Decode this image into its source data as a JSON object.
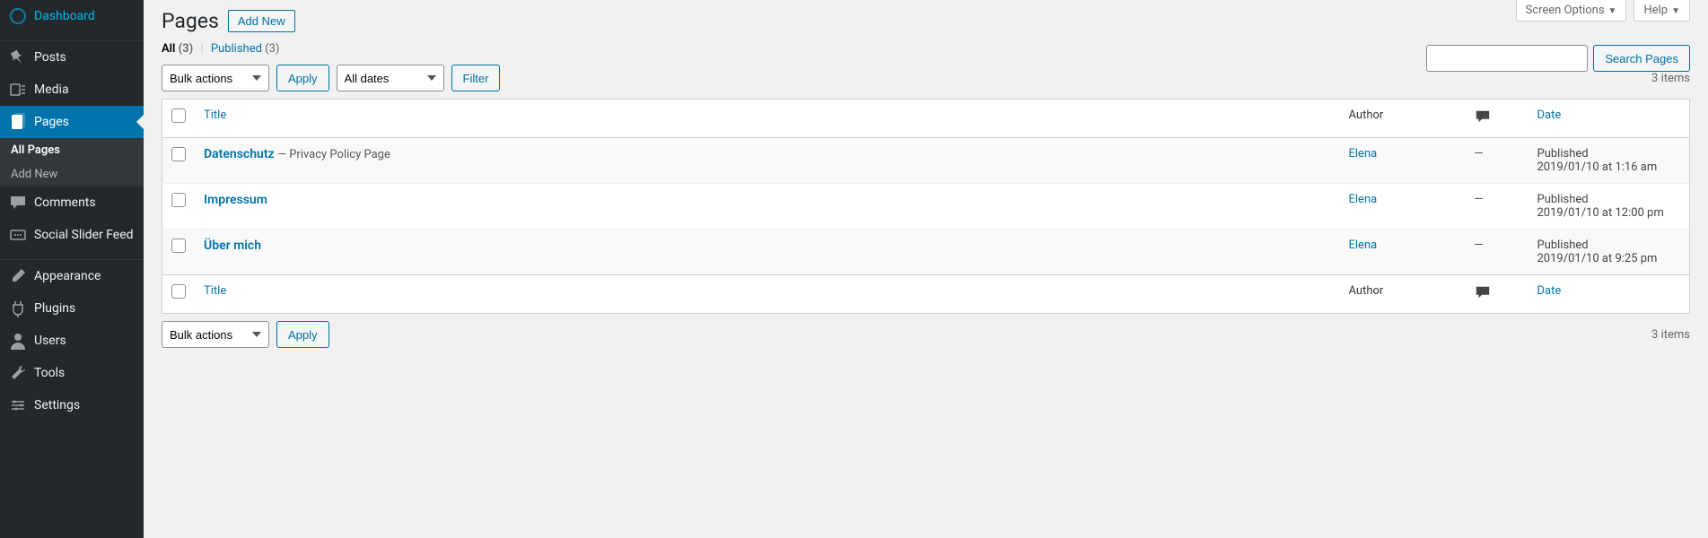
{
  "topTabs": {
    "screenOptions": "Screen Options",
    "help": "Help"
  },
  "sidebar": {
    "items": [
      {
        "label": "Dashboard"
      },
      {
        "label": "Posts"
      },
      {
        "label": "Media"
      },
      {
        "label": "Pages"
      },
      {
        "label": "Comments"
      },
      {
        "label": "Social Slider Feed"
      },
      {
        "label": "Appearance"
      },
      {
        "label": "Plugins"
      },
      {
        "label": "Users"
      },
      {
        "label": "Tools"
      },
      {
        "label": "Settings"
      }
    ],
    "sub": {
      "allPages": "All Pages",
      "addNew": "Add New"
    }
  },
  "header": {
    "title": "Pages",
    "addNew": "Add New"
  },
  "filters": {
    "allLabel": "All",
    "allCount": "(3)",
    "publishedLabel": "Published",
    "publishedCount": "(3)"
  },
  "search": {
    "button": "Search Pages"
  },
  "bulk": {
    "selected": "Bulk actions",
    "apply": "Apply"
  },
  "dateFilter": {
    "selected": "All dates",
    "filter": "Filter"
  },
  "itemsCount": "3 items",
  "columns": {
    "title": "Title",
    "author": "Author",
    "date": "Date"
  },
  "rows": [
    {
      "title": "Datenschutz",
      "note": " — Privacy Policy Page",
      "author": "Elena",
      "comments": "—",
      "status": "Published",
      "date": "2019/01/10 at 1:16 am"
    },
    {
      "title": "Impressum",
      "note": "",
      "author": "Elena",
      "comments": "—",
      "status": "Published",
      "date": "2019/01/10 at 12:00 pm"
    },
    {
      "title": "Über mich",
      "note": "",
      "author": "Elena",
      "comments": "—",
      "status": "Published",
      "date": "2019/01/10 at 9:25 pm"
    }
  ]
}
